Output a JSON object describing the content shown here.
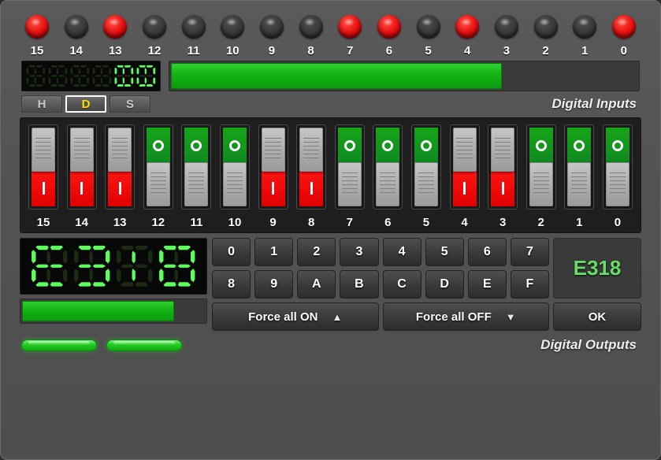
{
  "inputs": {
    "section_label": "Digital Inputs",
    "leds": [
      {
        "bit": "15",
        "state": "on"
      },
      {
        "bit": "14",
        "state": "off"
      },
      {
        "bit": "13",
        "state": "on"
      },
      {
        "bit": "12",
        "state": "off"
      },
      {
        "bit": "11",
        "state": "off"
      },
      {
        "bit": "10",
        "state": "off"
      },
      {
        "bit": "9",
        "state": "off"
      },
      {
        "bit": "8",
        "state": "off"
      },
      {
        "bit": "7",
        "state": "on"
      },
      {
        "bit": "6",
        "state": "on"
      },
      {
        "bit": "5",
        "state": "off"
      },
      {
        "bit": "4",
        "state": "on"
      },
      {
        "bit": "3",
        "state": "off"
      },
      {
        "bit": "2",
        "state": "off"
      },
      {
        "bit": "1",
        "state": "off"
      },
      {
        "bit": "0",
        "state": "on"
      }
    ],
    "display_value": "0000",
    "display_digits": [
      "",
      "",
      "",
      "",
      "0",
      "0"
    ],
    "bar_percent": 71,
    "modes": [
      {
        "label": "H",
        "active": false
      },
      {
        "label": "D",
        "active": true
      },
      {
        "label": "S",
        "active": false
      }
    ]
  },
  "outputs": {
    "section_label": "Digital Outputs",
    "switches": [
      {
        "bit": "15",
        "state": "I"
      },
      {
        "bit": "14",
        "state": "I"
      },
      {
        "bit": "13",
        "state": "I"
      },
      {
        "bit": "12",
        "state": "O"
      },
      {
        "bit": "11",
        "state": "O"
      },
      {
        "bit": "10",
        "state": "O"
      },
      {
        "bit": "9",
        "state": "I"
      },
      {
        "bit": "8",
        "state": "I"
      },
      {
        "bit": "7",
        "state": "O"
      },
      {
        "bit": "6",
        "state": "O"
      },
      {
        "bit": "5",
        "state": "O"
      },
      {
        "bit": "4",
        "state": "I"
      },
      {
        "bit": "3",
        "state": "I"
      },
      {
        "bit": "2",
        "state": "O"
      },
      {
        "bit": "1",
        "state": "O"
      },
      {
        "bit": "0",
        "state": "O"
      }
    ],
    "display_value": "E318",
    "display_digits": [
      "E",
      "3",
      "1",
      "8"
    ],
    "bar_percent": 83,
    "value_badge": "E318",
    "keys_row1": [
      "0",
      "1",
      "2",
      "3",
      "4",
      "5",
      "6",
      "7"
    ],
    "keys_row2": [
      "8",
      "9",
      "A",
      "B",
      "C",
      "D",
      "E",
      "F"
    ],
    "force_on_label": "Force all ON",
    "force_on_arrow": "▲",
    "force_off_label": "Force all OFF",
    "force_off_arrow": "▼",
    "ok_label": "OK",
    "status_pills": [
      "on",
      "on"
    ]
  },
  "colors": {
    "led_on": "#e80d0d",
    "led_off": "#3a3a3a",
    "switch_on": "#ff1414",
    "switch_off": "#17a417",
    "segment_on": "#5dfd5d",
    "segment_off": "#1b2a12",
    "bar_green": "#12b412",
    "badge_green": "#66dd66",
    "active_mode": "#ffe400"
  }
}
